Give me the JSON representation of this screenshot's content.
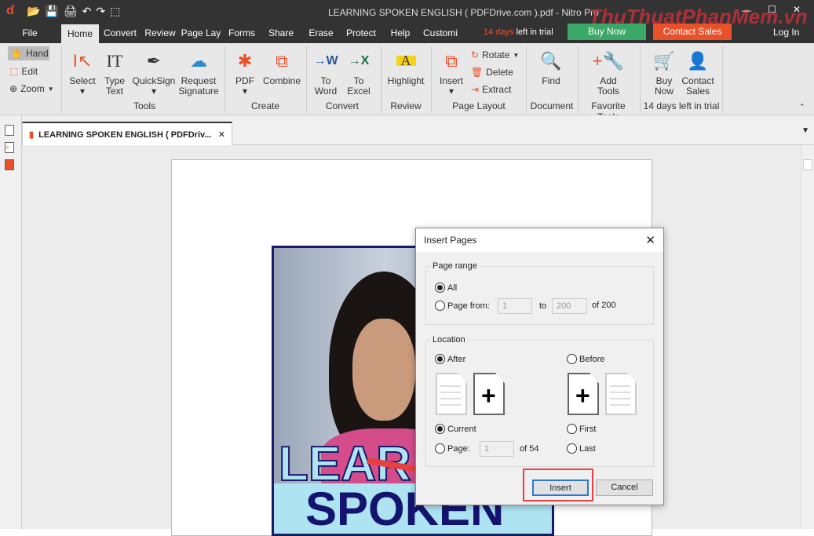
{
  "titlebar": {
    "title": "LEARNING SPOKEN ENGLISH ( PDFDrive.com ).pdf - Nitro Pro",
    "watermark": "ThuThuatPhanMem.vn"
  },
  "menu": {
    "file": "File",
    "tabs": [
      "Home",
      "Convert",
      "Review",
      "Page Lay",
      "Forms",
      "Share",
      "Erase",
      "Protect",
      "Help",
      "Customi"
    ],
    "trial_days": "14 days",
    "trial_rest": "left in trial",
    "buy_now": "Buy Now",
    "contact_sales": "Contact Sales",
    "login": "Log In"
  },
  "ribbon": {
    "hand": "Hand",
    "edit": "Edit",
    "zoom": "Zoom",
    "buttons": [
      {
        "label": "Select"
      },
      {
        "label": "Type\nText"
      },
      {
        "label": "QuickSign"
      },
      {
        "label": "Request\nSignature"
      },
      {
        "label": "PDF"
      },
      {
        "label": "Combine"
      },
      {
        "label": "To\nWord"
      },
      {
        "label": "To\nExcel"
      },
      {
        "label": "Highlight"
      },
      {
        "label": "Insert"
      },
      {
        "label": "Find"
      },
      {
        "label": "Add\nTools"
      },
      {
        "label": "Buy\nNow"
      },
      {
        "label": "Contact\nSales"
      }
    ],
    "rotate": "Rotate",
    "delete": "Delete",
    "extract": "Extract",
    "groups": [
      "Tools",
      "Create",
      "Convert",
      "Review",
      "Page Layout",
      "Document",
      "Favorite Tools",
      "14 days left in trial"
    ]
  },
  "doc_tab": {
    "title": "LEARNING SPOKEN ENGLISH ( PDFDriv..."
  },
  "cover": {
    "line1": "LEAR",
    "line2": "SPOKEN"
  },
  "dialog": {
    "title": "Insert Pages",
    "page_range": "Page range",
    "all": "All",
    "page_from": "Page from:",
    "from_value": "1",
    "to": "to",
    "to_value": "200",
    "of_total": "of 200",
    "location": "Location",
    "after": "After",
    "before": "Before",
    "current": "Current",
    "page": "Page:",
    "page_value": "1",
    "of_pages": "of 54",
    "first": "First",
    "last": "Last",
    "insert": "Insert",
    "cancel": "Cancel"
  },
  "colors": {
    "accent": "#e8512a",
    "buy": "#3aa867",
    "contact": "#e8512a",
    "highlight_box": "#e84040"
  }
}
